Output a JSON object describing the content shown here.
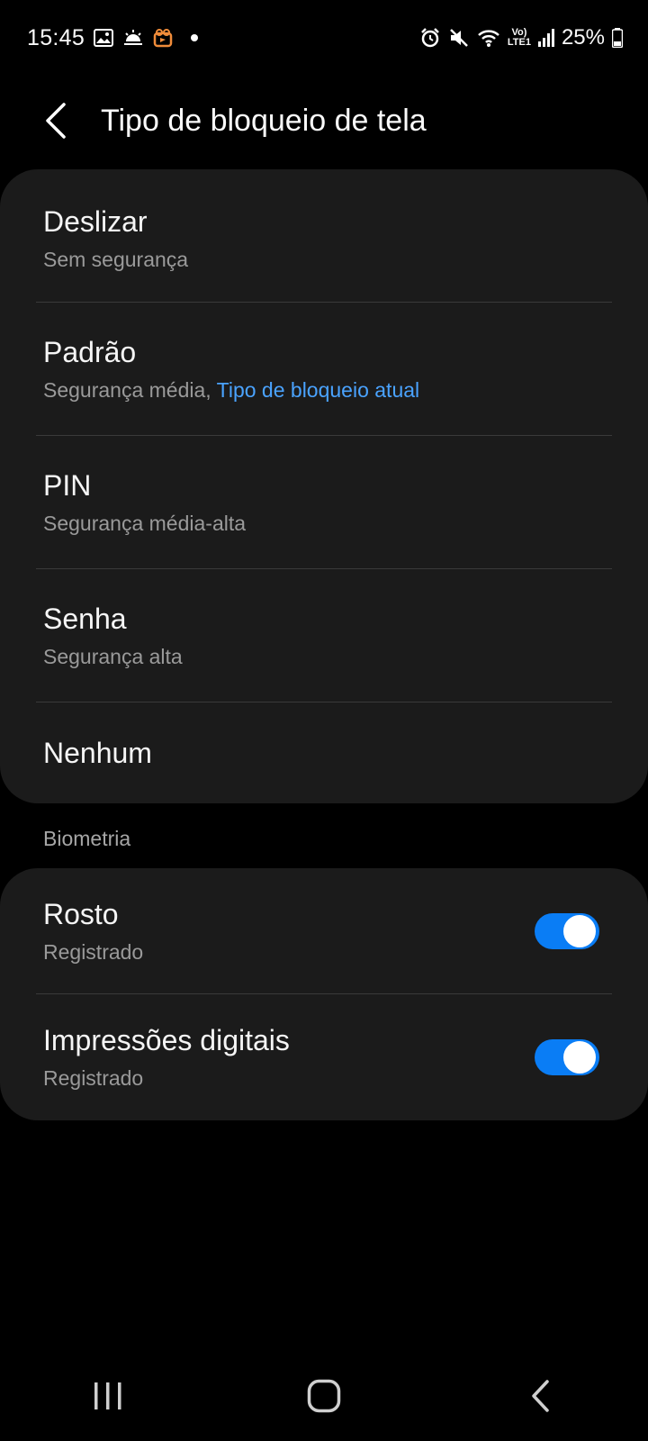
{
  "status_bar": {
    "time": "15:45",
    "battery_percent": "25%",
    "network_label": "LTE1",
    "volte_label": "Vo)",
    "left_icons": [
      "gallery-icon",
      "weather-icon",
      "app-notification-icon",
      "more-notifications-dot"
    ],
    "right_icons": [
      "alarm-icon",
      "mute-icon",
      "wifi-icon",
      "signal-icon",
      "battery-icon"
    ]
  },
  "header": {
    "title": "Tipo de bloqueio de tela"
  },
  "lock_types": [
    {
      "title": "Deslizar",
      "subtitle": "Sem segurança",
      "subtitle_accent": ""
    },
    {
      "title": "Padrão",
      "subtitle": "Segurança média, ",
      "subtitle_accent": "Tipo de bloqueio atual"
    },
    {
      "title": "PIN",
      "subtitle": "Segurança média-alta",
      "subtitle_accent": ""
    },
    {
      "title": "Senha",
      "subtitle": "Segurança alta",
      "subtitle_accent": ""
    },
    {
      "title": "Nenhum",
      "subtitle": "",
      "subtitle_accent": ""
    }
  ],
  "biometrics": {
    "section_label": "Biometria",
    "items": [
      {
        "title": "Rosto",
        "subtitle": "Registrado",
        "enabled": true
      },
      {
        "title": "Impressões digitais",
        "subtitle": "Registrado",
        "enabled": true
      }
    ]
  },
  "colors": {
    "accent": "#4aa3ff",
    "toggle_on": "#0a7df5",
    "card_bg": "#1b1b1b",
    "background": "#000000"
  }
}
